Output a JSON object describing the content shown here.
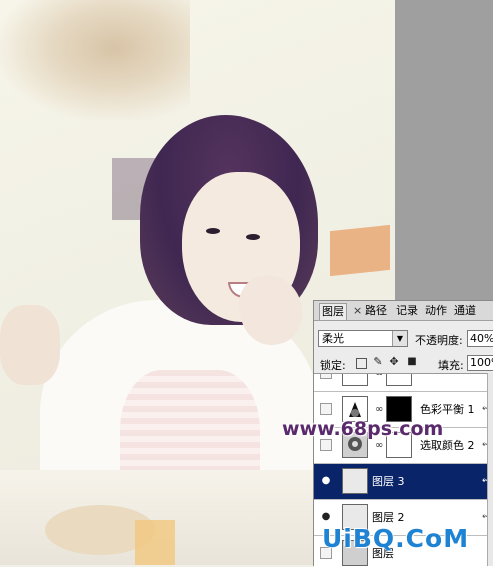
{
  "panel": {
    "tabs": [
      {
        "label": "图层",
        "active": true
      },
      {
        "label": "路径",
        "active": false
      },
      {
        "label": "记录",
        "active": false
      },
      {
        "label": "动作",
        "active": false
      },
      {
        "label": "通道",
        "active": false
      }
    ],
    "close_glyph": "×",
    "blend_mode": "柔光",
    "opacity_label": "不透明度:",
    "opacity_value": "40%",
    "lock_label": "锁定:",
    "fill_label": "填充:",
    "fill_value": "100%",
    "layers": [
      {
        "name": "",
        "visible": false,
        "selected": false,
        "thumb": "adjustment",
        "mask": "white"
      },
      {
        "name": "色彩平衡 1",
        "visible": false,
        "selected": false,
        "thumb": "adjustment",
        "mask": "black"
      },
      {
        "name": "选取颜色 2",
        "visible": false,
        "selected": false,
        "thumb": "adjustment",
        "mask": "white"
      },
      {
        "name": "图层 3",
        "visible": true,
        "selected": true,
        "thumb": "image",
        "mask": ""
      },
      {
        "name": "图层 2",
        "visible": true,
        "selected": false,
        "thumb": "image",
        "mask": ""
      },
      {
        "name": "图层",
        "visible": false,
        "selected": false,
        "thumb": "adjustment",
        "mask": ""
      }
    ]
  },
  "watermarks": {
    "top": "www.68ps.com",
    "bottom": "UiBQ.CoM"
  },
  "colors": {
    "selection": "#0a246a",
    "canvas_gray": "#9f9f9f"
  }
}
